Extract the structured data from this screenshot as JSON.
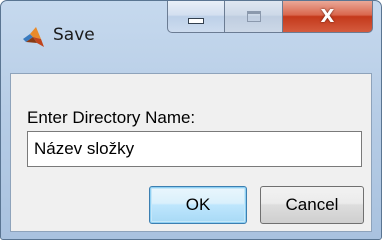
{
  "window": {
    "title": "Save",
    "icon": "matlab-logo-icon",
    "close_glyph": "X"
  },
  "dialog": {
    "label": "Enter Directory Name:",
    "input_value": "Název složky",
    "ok_label": "OK",
    "cancel_label": "Cancel"
  },
  "colors": {
    "frame": "#b9cfe8",
    "client": "#f0f0f0",
    "close_button": "#c9462a",
    "ok_focus": "#3c7fb1"
  }
}
